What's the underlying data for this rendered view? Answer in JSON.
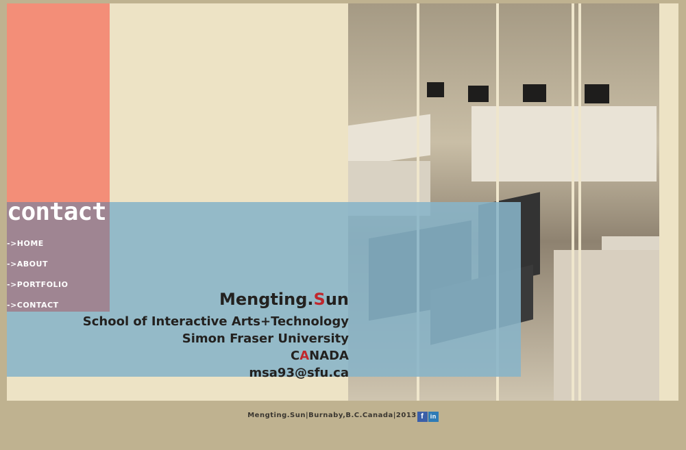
{
  "page": {
    "title": "contact"
  },
  "nav": [
    {
      "label": "->HOME"
    },
    {
      "label": "->ABOUT"
    },
    {
      "label": "->PORTFOLIO"
    },
    {
      "label": "->CONTACT"
    }
  ],
  "card": {
    "name_first": "Mengting.",
    "name_initial": "S",
    "name_rest": "un",
    "school": "School of Interactive Arts+Technology",
    "university": "Simon Fraser University",
    "country_first": "C",
    "country_initial": "A",
    "country_rest": "NADA",
    "email": "msa93@sfu.ca"
  },
  "footer": {
    "text": "Mengting.Sun|Burnaby,B.C.Canada|2013",
    "facebook_glyph": "f",
    "linkedin_glyph": "in"
  },
  "colors": {
    "background": "#bfb290",
    "panel": "#ede3c5",
    "salmon": "#f38e78",
    "blue": "#87b4c8",
    "purple": "#9f8592",
    "accent": "#c0272d"
  },
  "icons": [
    "facebook-icon",
    "linkedin-icon"
  ]
}
